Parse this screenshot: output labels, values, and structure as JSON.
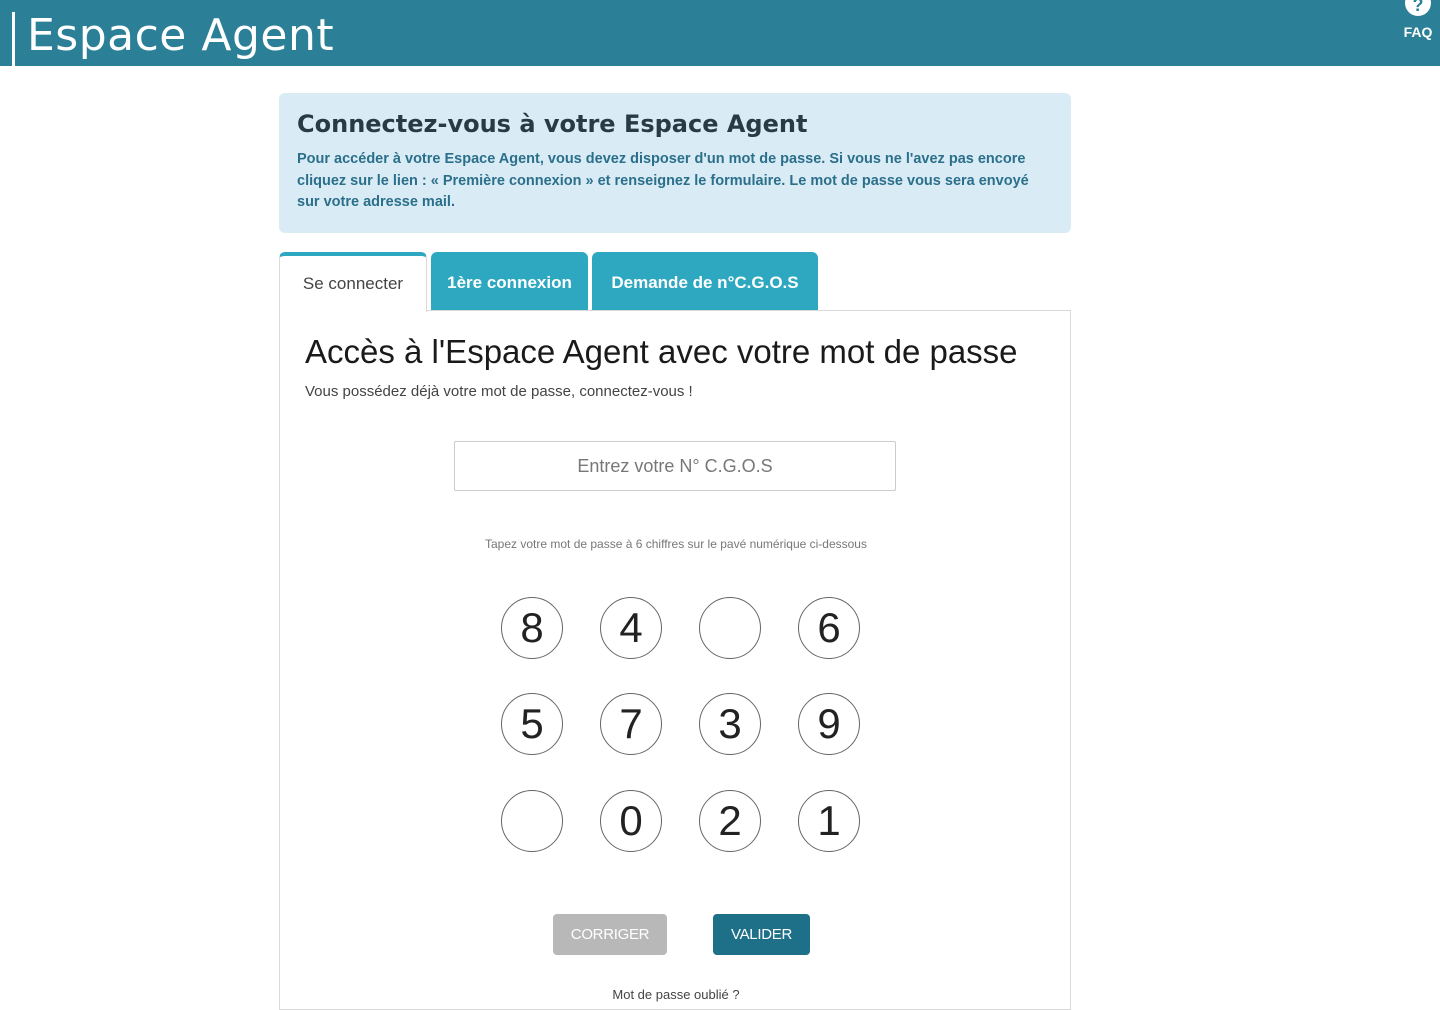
{
  "header": {
    "brand": "Espace Agent",
    "faq_label": "FAQ",
    "faq_icon": "question-circle-icon",
    "bg_color": "#2b7f96"
  },
  "info": {
    "title": "Connectez-vous à votre Espace Agent",
    "text": "Pour accéder à votre Espace Agent, vous devez disposer d'un mot de passe. Si vous ne l'avez pas encore cliquez sur le lien : « Première connexion » et renseignez le formulaire. Le mot de passe vous sera envoyé sur votre adresse mail."
  },
  "tabs": [
    {
      "label": "Se connecter",
      "active": true
    },
    {
      "label": "1ère connexion",
      "active": false
    },
    {
      "label": "Demande de n°C.G.O.S",
      "active": false
    }
  ],
  "login": {
    "title": "Accès à l'Espace Agent avec votre mot de passe",
    "subtitle": "Vous possédez déjà votre mot de passe, connectez-vous !",
    "cgos_placeholder": "Entrez votre N° C.G.O.S",
    "keypad_hint": "Tapez votre mot de passe à 6 chiffres sur le pavé numérique ci-dessous",
    "keypad": [
      [
        "8",
        "4",
        "",
        "6"
      ],
      [
        "5",
        "7",
        "3",
        "9"
      ],
      [
        "",
        "0",
        "2",
        "1"
      ]
    ],
    "corriger_label": "CORRIGER",
    "valider_label": "VALIDER",
    "forgot_label": "Mot de passe oublié ?"
  },
  "colors": {
    "accent": "#2ea7c1",
    "valider": "#1e7088",
    "corriger": "#b8b8b8",
    "info_bg": "#d9ecf5"
  }
}
